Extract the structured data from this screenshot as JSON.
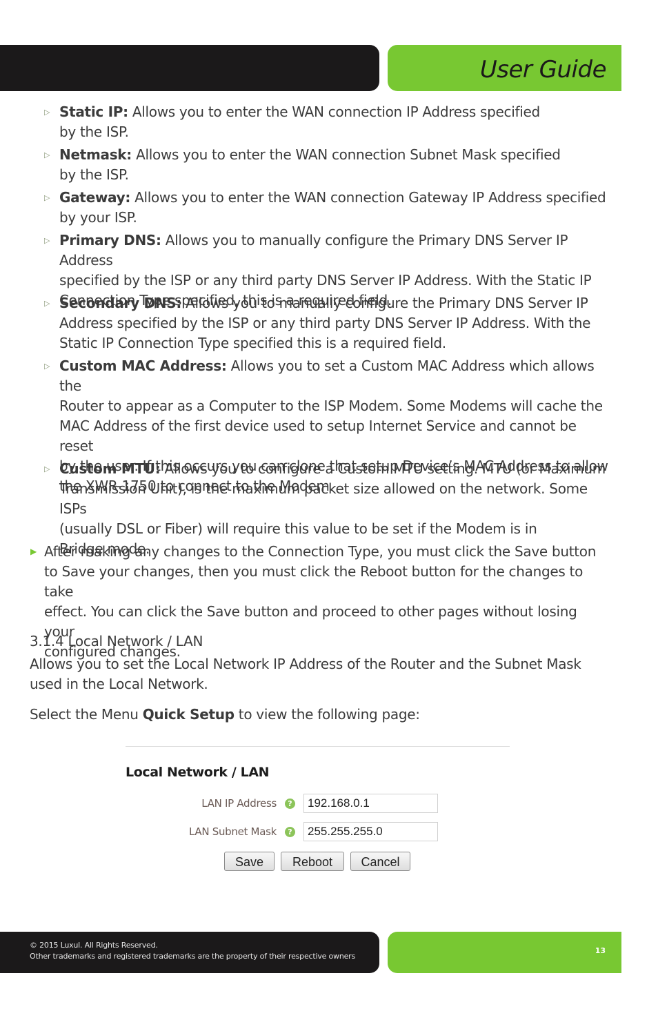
{
  "header": {
    "title": "User Guide"
  },
  "sub_bullets": [
    {
      "term": "Static IP:",
      "lines": [
        "Allows you to enter the WAN connection IP Address specified",
        "by the ISP."
      ]
    },
    {
      "term": "Netmask:",
      "lines": [
        "Allows you to enter the WAN connection Subnet Mask specified",
        "by the ISP."
      ]
    },
    {
      "term": "Gateway:",
      "lines": [
        "Allows you to enter the WAN connection Gateway IP Address specified",
        "by your ISP."
      ]
    },
    {
      "term": "Primary DNS:",
      "lines": [
        "Allows you to manually configure the Primary DNS Server IP Address",
        "specified by the ISP or any third party DNS Server IP Address. With the Static IP",
        "Connection Type specified, this is a required field."
      ]
    },
    {
      "term": "Secondary DNS:",
      "lines": [
        "Allows you to manually configure the Primary DNS Server IP",
        "Address specified by the ISP or any third party DNS Server IP Address. With the",
        "Static IP Connection Type specified this is a required field."
      ]
    },
    {
      "term": "Custom MAC Address:",
      "lines": [
        "Allows you to set a Custom MAC Address which allows the",
        "Router to appear as a Computer to the ISP Modem. Some Modems will cache the",
        "MAC Address of the first device used to setup Internet Service and cannot be reset",
        "by the user. If this occurs you can clone that setup Device’s MAC Address to allow",
        "the XWR-1750 to connect to the Modem."
      ]
    },
    {
      "term": "Custom MTU:",
      "lines": [
        "Allows you to configure a Custom MTU setting. MTU (or Maximum",
        "Transmission Unit), is the maximum packet size allowed on the network. Some ISPs",
        "(usually DSL or Fiber) will require this value to be set if the Modem is in",
        "Bridge mode."
      ]
    }
  ],
  "main_bullet": {
    "lines": [
      "After making any changes to the Connection Type, you must click the Save button",
      "to Save your changes, then you must click the Reboot button for the changes to take",
      "effect. You can click the Save button and proceed to other pages without losing your",
      "configured changes."
    ]
  },
  "section": {
    "heading": "3.1.4 Local Network / LAN",
    "description_lines": [
      "Allows you to set the Local Network IP Address of the Router and the Subnet Mask",
      "used in the Local Network."
    ],
    "instruction_prefix": "Select the Menu ",
    "instruction_bold": "Quick Setup",
    "instruction_suffix": " to view the following page:"
  },
  "panel": {
    "heading": "Local Network / LAN",
    "fields": [
      {
        "label": "LAN IP Address",
        "value": "192.168.0.1",
        "help_icon": "question-icon"
      },
      {
        "label": "LAN Subnet Mask",
        "value": "255.255.255.0",
        "help_icon": "question-icon"
      }
    ],
    "buttons": {
      "save": "Save",
      "reboot": "Reboot",
      "cancel": "Cancel"
    }
  },
  "footer": {
    "copyright": "© 2015  Luxul. All Rights Reserved.",
    "trademark": "Other trademarks and registered trademarks are the property of their respective owners",
    "page_number": "13"
  },
  "colors": {
    "brand_green": "#78c832",
    "bar_black": "#1b191a",
    "text": "#3b3b3b"
  }
}
